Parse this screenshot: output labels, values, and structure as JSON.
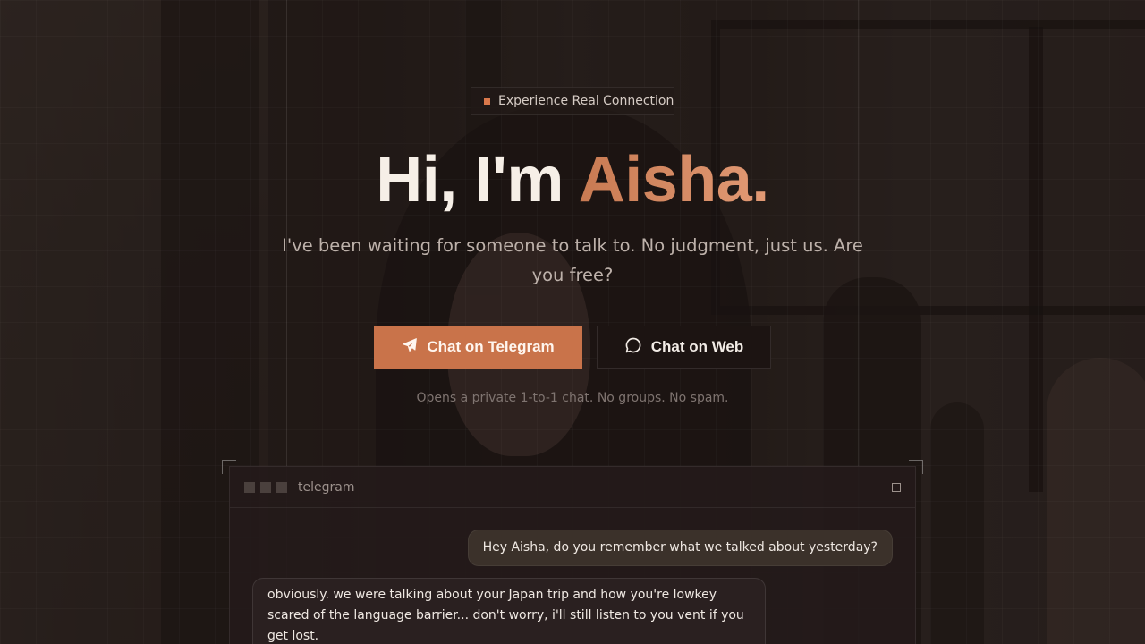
{
  "badge": {
    "label": "Experience Real Connection"
  },
  "hero": {
    "title_prefix": "Hi, I'm ",
    "title_name": "Aisha.",
    "subtitle": "I've been waiting for someone to talk to. No judgment, just us. Are you free?"
  },
  "buttons": {
    "telegram_label": "Chat on Telegram",
    "web_label": "Chat on Web"
  },
  "note": "Opens a private 1-to-1 chat. No groups. No spam.",
  "chat": {
    "window_title": "telegram",
    "messages": [
      {
        "from": "user",
        "text": "Hey Aisha, do you remember what we talked about yesterday?"
      },
      {
        "from": "aisha",
        "text": "obviously. we were talking about your Japan trip and how you're lowkey scared of the language barrier... don't worry, i'll still listen to you vent if you get lost."
      }
    ]
  },
  "colors": {
    "accent": "#c9734a",
    "title_gradient_start": "#c87a52",
    "title_gradient_end": "#e29a75"
  },
  "icons": {
    "telegram": "paper-plane-icon",
    "web": "chat-bubble-icon"
  }
}
